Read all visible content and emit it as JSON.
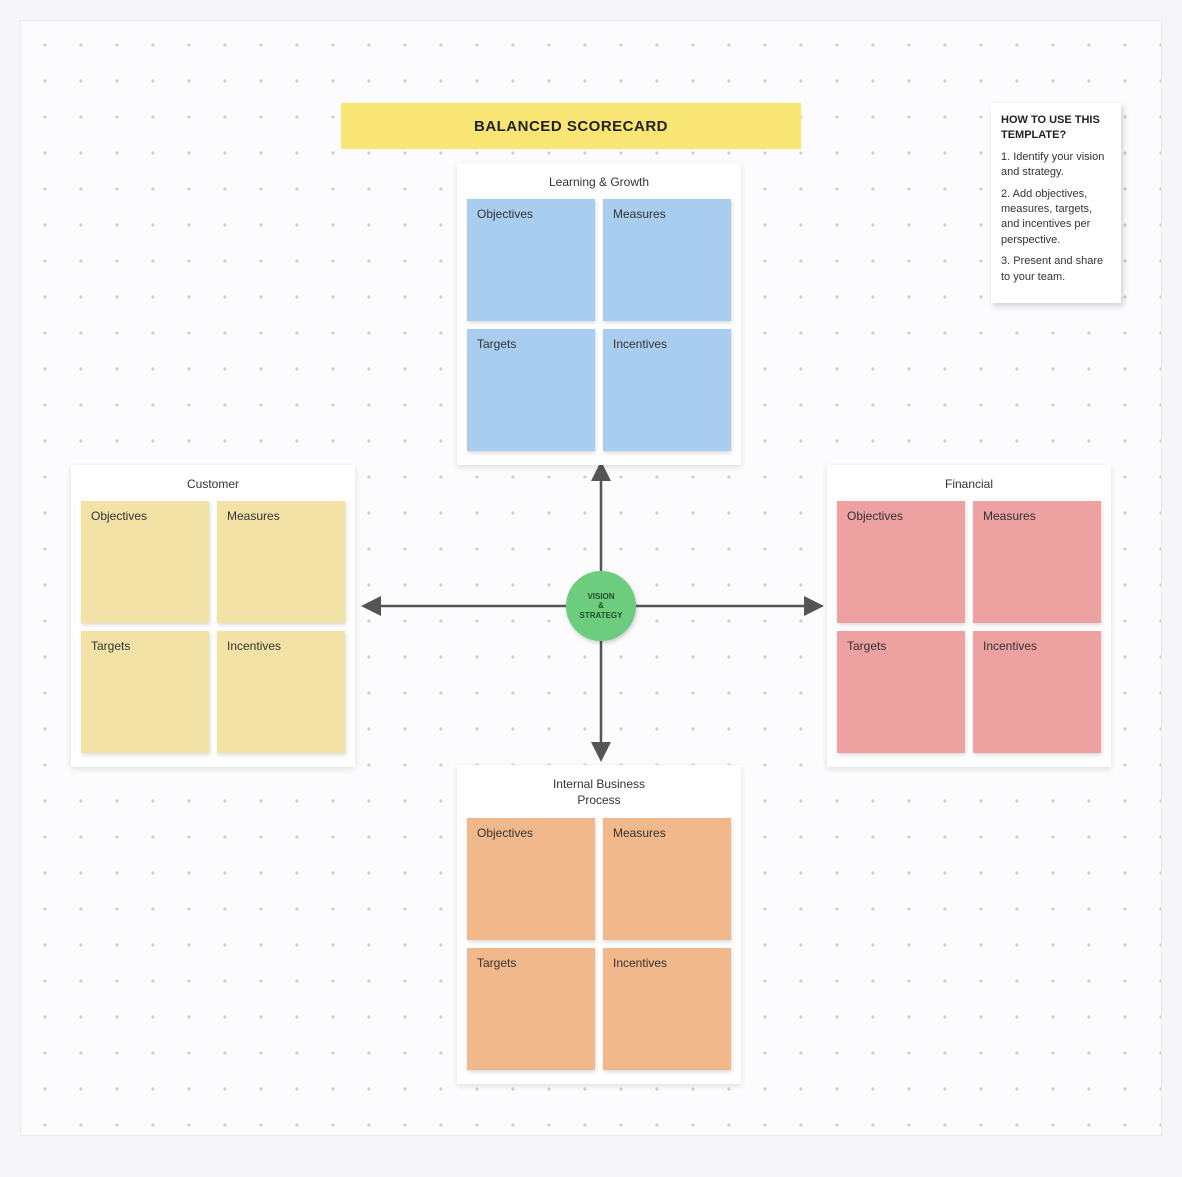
{
  "title": "BALANCED SCORECARD",
  "hub": {
    "line1": "VISION",
    "line2": "&",
    "line3": "STRATEGY"
  },
  "help": {
    "title": "HOW TO USE THIS TEMPLATE?",
    "steps": [
      "1. Identify your vision and strategy.",
      "2. Add objectives, measures, targets, and incentives per perspective.",
      "3. Present and share to your team."
    ]
  },
  "card_labels": {
    "objectives": "Objectives",
    "measures": "Measures",
    "targets": "Targets",
    "incentives": "Incentives"
  },
  "perspectives": {
    "top": {
      "title": "Learning & Growth"
    },
    "right": {
      "title": "Financial"
    },
    "left": {
      "title": "Customer"
    },
    "bottom": {
      "title_line1": "Internal Business",
      "title_line2": "Process"
    }
  },
  "colors": {
    "title_bg": "#f8e573",
    "hub_bg": "#6dcd7e",
    "top_cards": "#a8cdee",
    "right_cards": "#eda1a1",
    "left_cards": "#f2e2a6",
    "bottom_cards": "#f0b88b",
    "arrow": "#555"
  }
}
